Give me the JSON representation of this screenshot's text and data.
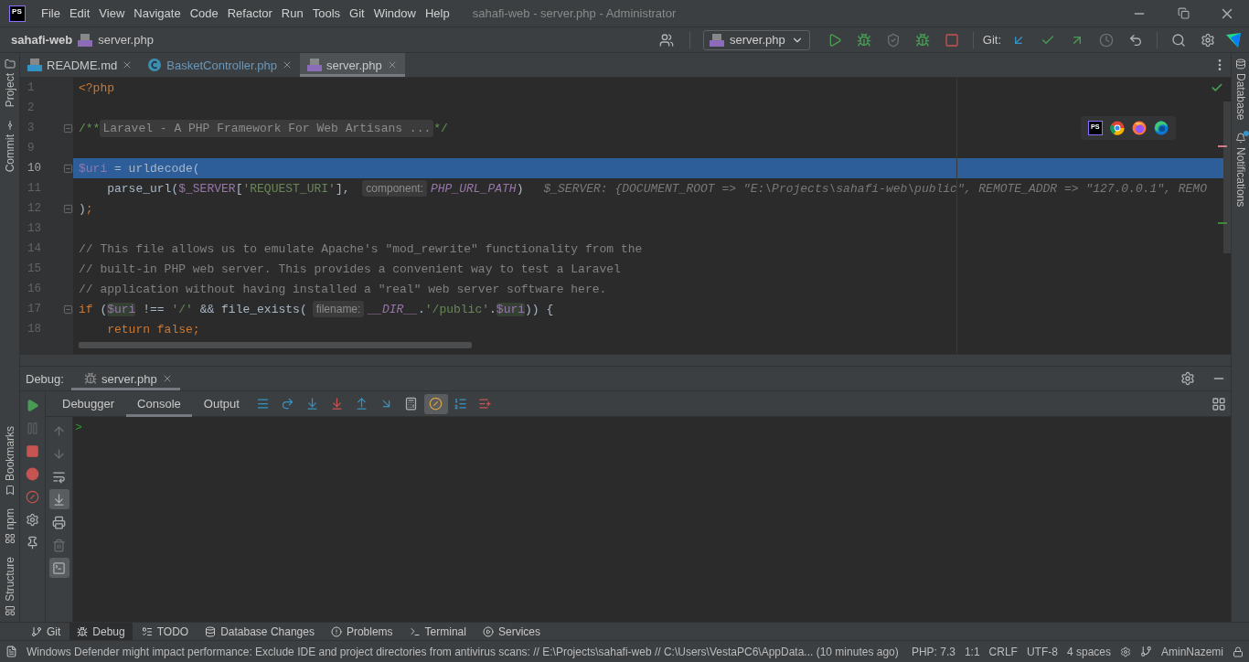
{
  "title_bar": {
    "logo": "PS",
    "menu": [
      "File",
      "Edit",
      "View",
      "Navigate",
      "Code",
      "Refactor",
      "Run",
      "Tools",
      "Git",
      "Window",
      "Help"
    ],
    "title": "sahafi-web - server.php - Administrator"
  },
  "nav_bar": {
    "breadcrumb": [
      "sahafi-web",
      "server.php"
    ],
    "run_config": "server.php",
    "git_label": "Git:"
  },
  "left_stripe": {
    "top": [
      "Project",
      "Commit"
    ],
    "bottom": [
      "Bookmarks",
      "npm",
      "Structure"
    ]
  },
  "right_stripe": [
    {
      "label": "Database",
      "unread": false
    },
    {
      "label": "Notifications",
      "unread": true
    }
  ],
  "editor_tabs": [
    {
      "label": "README.md",
      "kind": "md",
      "modified": false,
      "selected": false
    },
    {
      "label": "BasketController.php",
      "kind": "class",
      "modified": true,
      "selected": false
    },
    {
      "label": "server.php",
      "kind": "php",
      "modified": false,
      "selected": true
    }
  ],
  "editor": {
    "browser_popup": {
      "ide_logo": "PS"
    },
    "lines": [
      {
        "number": "1",
        "highlighted": false,
        "fold_marker": false,
        "tokens": [
          {
            "text": "<?php",
            "kind": "keyword"
          }
        ]
      },
      {
        "number": "2",
        "highlighted": false,
        "fold_marker": false
      },
      {
        "number": "3",
        "highlighted": false,
        "fold_marker": true,
        "tokens": [
          {
            "text": "/**",
            "kind": "doc"
          },
          {
            "text": "Laravel - A PHP Framework For Web Artisans ...",
            "kind": "fold"
          },
          {
            "text": "*/",
            "kind": "doc"
          }
        ]
      },
      {
        "number": "9",
        "highlighted": false,
        "fold_marker": false
      },
      {
        "number": "10",
        "highlighted": true,
        "fold_marker": true,
        "tokens": [
          {
            "text": "$uri",
            "kind": "variable"
          },
          {
            "text": " = urldecode(",
            "kind": "text"
          }
        ]
      },
      {
        "number": "11",
        "highlighted": false,
        "fold_marker": false,
        "tokens": [
          {
            "text": "    parse_url(",
            "kind": "text"
          },
          {
            "text": "$_SERVER",
            "kind": "variable"
          },
          {
            "text": "[",
            "kind": "text"
          },
          {
            "text": "'REQUEST_URI'",
            "kind": "string"
          },
          {
            "text": "], ",
            "kind": "text"
          },
          {
            "text": "component:",
            "kind": "hint"
          },
          {
            "text": "PHP_URL_PATH",
            "kind": "constant"
          },
          {
            "text": ")",
            "kind": "text"
          },
          {
            "text": "$_SERVER: {DOCUMENT_ROOT => \"E:\\Projects\\sahafi-web\\public\", REMOTE_ADDR => \"127.0.0.1\", REMO",
            "kind": "inline"
          }
        ]
      },
      {
        "number": "12",
        "highlighted": false,
        "fold_marker": true,
        "tokens": [
          {
            "text": ")",
            "kind": "text"
          },
          {
            "text": ";",
            "kind": "keyword"
          }
        ]
      },
      {
        "number": "13",
        "highlighted": false,
        "fold_marker": false
      },
      {
        "number": "14",
        "highlighted": false,
        "fold_marker": false,
        "tokens": [
          {
            "text": "// This file allows us to emulate Apache's \"mod_rewrite\" functionality from the",
            "kind": "comment"
          }
        ]
      },
      {
        "number": "15",
        "highlighted": false,
        "fold_marker": false,
        "tokens": [
          {
            "text": "// built-in PHP web server. This provides a convenient way to test a Laravel",
            "kind": "comment"
          }
        ]
      },
      {
        "number": "16",
        "highlighted": false,
        "fold_marker": false,
        "tokens": [
          {
            "text": "// application without having installed a \"real\" web server software here.",
            "kind": "comment"
          }
        ]
      },
      {
        "number": "17",
        "highlighted": false,
        "fold_marker": true,
        "tokens": [
          {
            "text": "if",
            "kind": "keyword"
          },
          {
            "text": " (",
            "kind": "text"
          },
          {
            "text": "$uri",
            "kind": "usage"
          },
          {
            "text": " !== ",
            "kind": "text"
          },
          {
            "text": "'/'",
            "kind": "string"
          },
          {
            "text": " && file_exists(",
            "kind": "text"
          },
          {
            "text": "filename:",
            "kind": "hint"
          },
          {
            "text": "__DIR__",
            "kind": "constant"
          },
          {
            "text": ".",
            "kind": "text"
          },
          {
            "text": "'/public'",
            "kind": "string"
          },
          {
            "text": ".",
            "kind": "text"
          },
          {
            "text": "$uri",
            "kind": "usage"
          },
          {
            "text": ")) {",
            "kind": "text"
          }
        ]
      },
      {
        "number": "18",
        "highlighted": false,
        "fold_marker": false,
        "tokens": [
          {
            "text": "    return false;",
            "kind": "keyword"
          }
        ]
      }
    ]
  },
  "debug": {
    "title": "Debug:",
    "session_tab": "server.php",
    "side_actions": [
      {
        "kind": "resume",
        "disabled": false
      },
      {
        "kind": "pause",
        "disabled": true
      },
      {
        "kind": "stop",
        "disabled": false
      },
      {
        "kind": "breakpoints",
        "disabled": false
      },
      {
        "kind": "mute",
        "disabled": false
      },
      {
        "kind": "settings",
        "disabled": false
      },
      {
        "kind": "pin",
        "disabled": false
      }
    ],
    "tabs": [
      {
        "label": "Debugger",
        "selected": false
      },
      {
        "label": "Console",
        "selected": true
      },
      {
        "label": "Output",
        "selected": false
      }
    ],
    "step_actions": [
      {
        "kind": "frames",
        "selected": false
      },
      {
        "kind": "step-over",
        "selected": false
      },
      {
        "kind": "step-into",
        "selected": false
      },
      {
        "kind": "force-step-into",
        "selected": false
      },
      {
        "kind": "step-out",
        "selected": false
      },
      {
        "kind": "run-to-cursor",
        "selected": false
      },
      {
        "kind": "evaluate",
        "selected": false
      },
      {
        "kind": "class-filter",
        "selected": true
      },
      {
        "kind": "numbered-list",
        "selected": false
      },
      {
        "kind": "add-watch",
        "selected": false
      }
    ],
    "console_actions": [
      {
        "kind": "up",
        "disabled": true,
        "selected": false
      },
      {
        "kind": "down",
        "disabled": true,
        "selected": false
      },
      {
        "kind": "wrap",
        "disabled": false,
        "selected": false
      },
      {
        "kind": "scroll-end",
        "disabled": false,
        "selected": true
      },
      {
        "kind": "print",
        "disabled": false,
        "selected": false
      },
      {
        "kind": "trash",
        "disabled": true,
        "selected": false
      },
      {
        "kind": "terminal",
        "disabled": false,
        "selected": true
      }
    ],
    "console_prompt": ">"
  },
  "tool_tabs": [
    {
      "label": "Git",
      "kind": "git",
      "selected": false
    },
    {
      "label": "Debug",
      "kind": "debug",
      "selected": true
    },
    {
      "label": "TODO",
      "kind": "todo",
      "selected": false
    },
    {
      "label": "Database Changes",
      "kind": "database",
      "selected": false
    },
    {
      "label": "Problems",
      "kind": "problems",
      "selected": false
    },
    {
      "label": "Terminal",
      "kind": "terminal",
      "selected": false
    },
    {
      "label": "Services",
      "kind": "services",
      "selected": false
    }
  ],
  "status_bar": {
    "message": "Windows Defender might impact performance: Exclude IDE and project directories from antivirus scans: // E:\\Projects\\sahafi-web // C:\\Users\\VestaPC6\\AppData... (10 minutes ago)",
    "items": [
      "PHP: 7.3",
      "1:1",
      "CRLF",
      "UTF-8",
      "4 spaces"
    ],
    "user": "AminNazemi"
  }
}
